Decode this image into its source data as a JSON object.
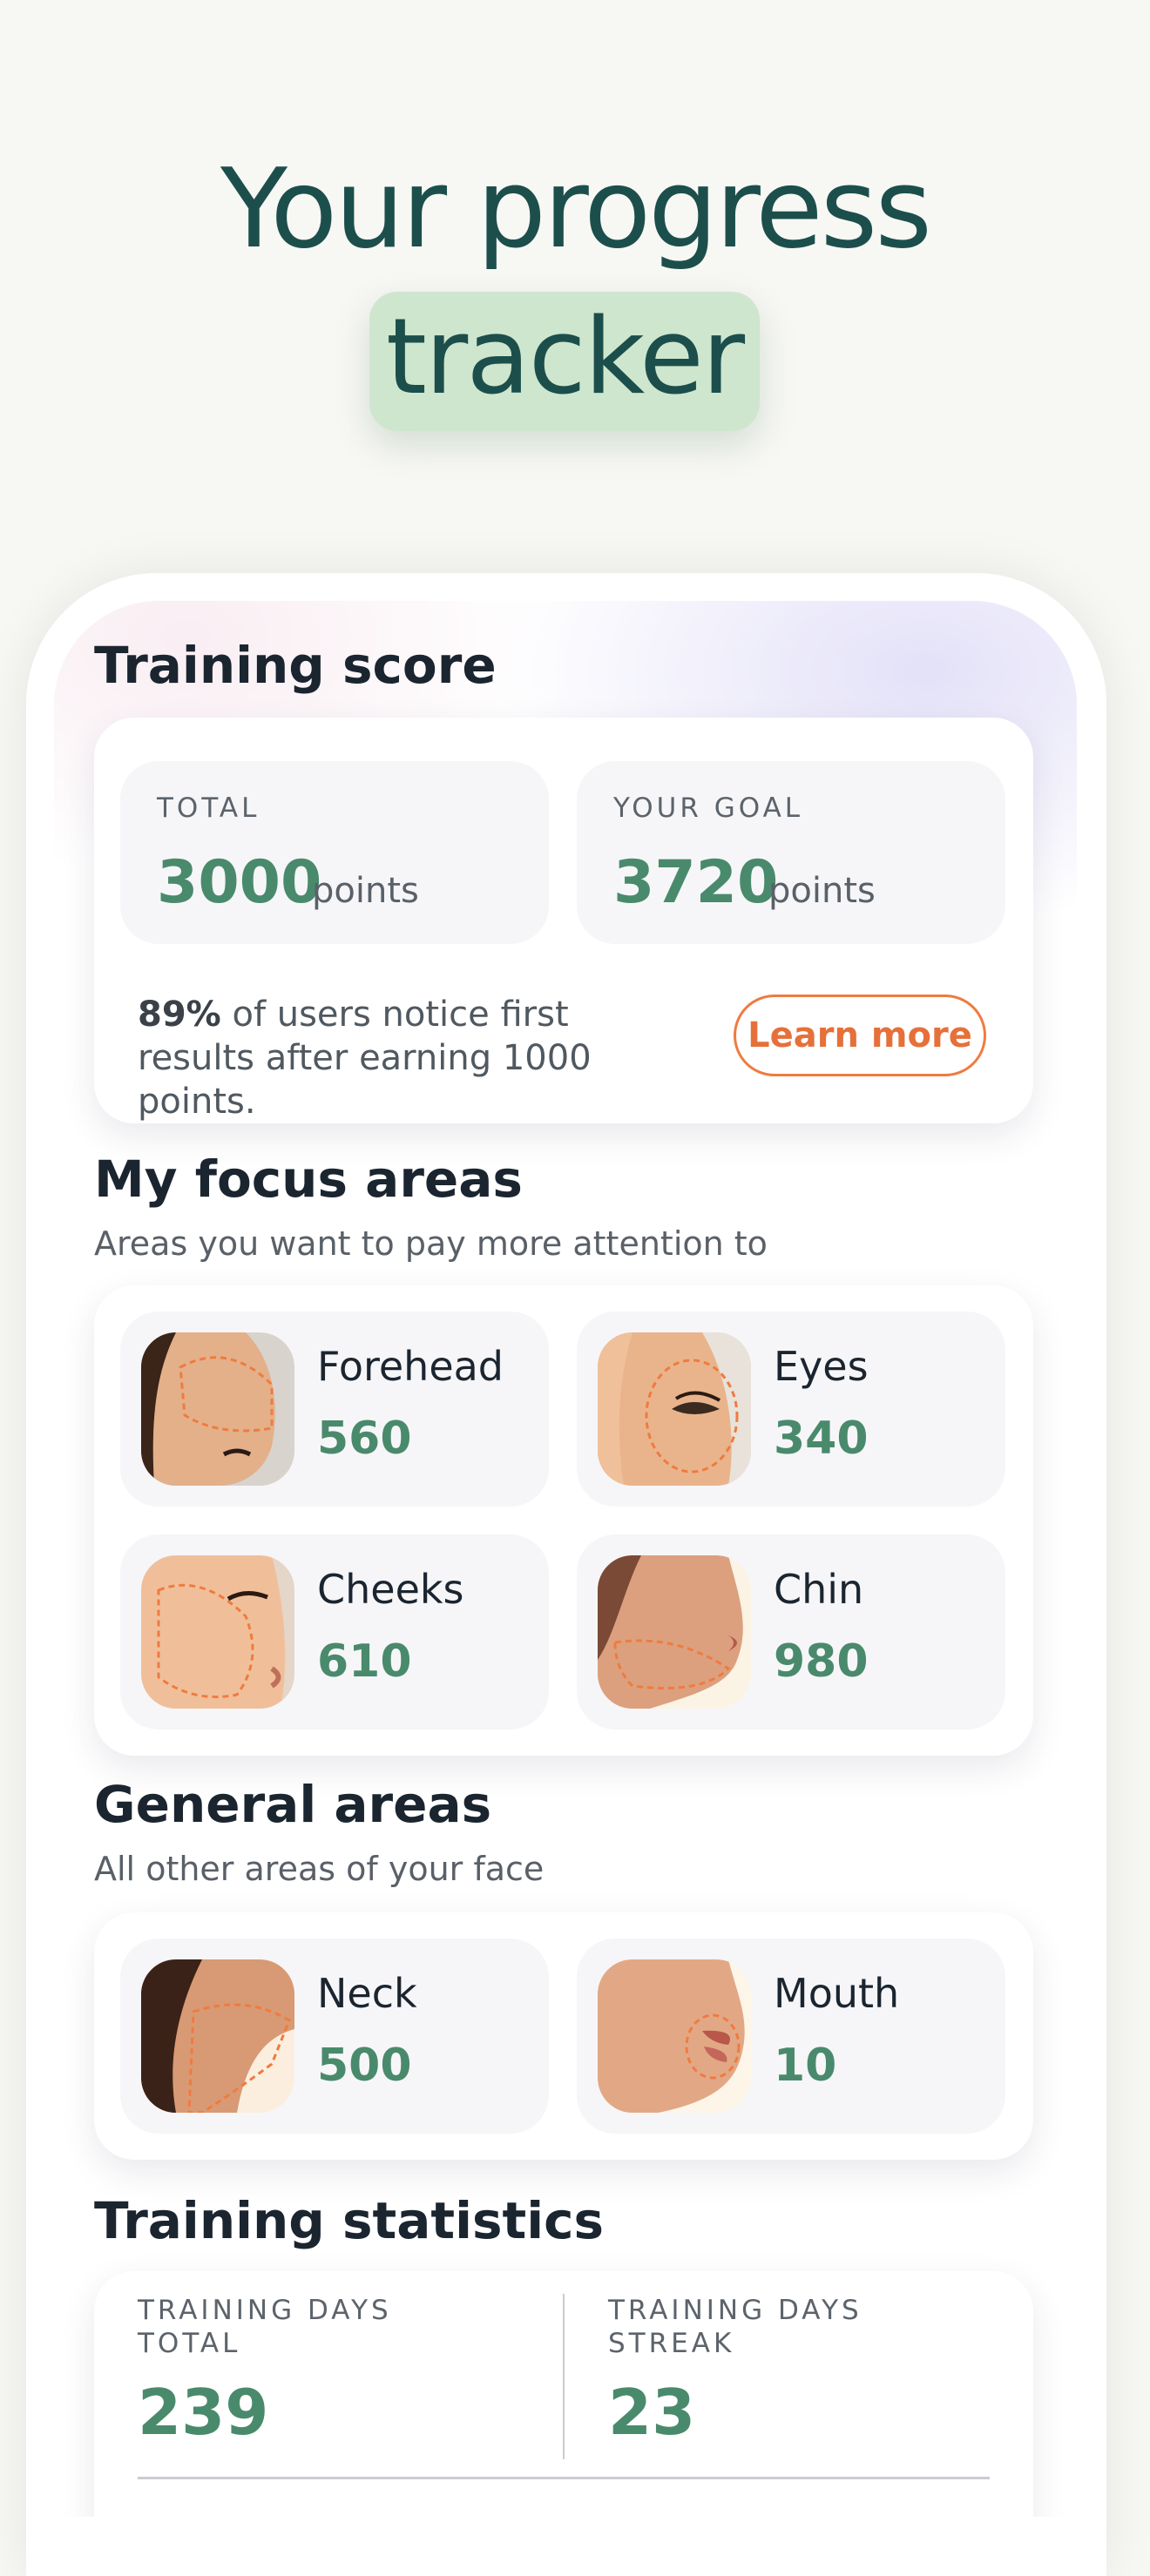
{
  "hero": {
    "line1": "Your progress",
    "line2": "tracker"
  },
  "training_score": {
    "title": "Training score",
    "total": {
      "label": "TOTAL",
      "value": "3000",
      "unit": "points"
    },
    "goal": {
      "label": "YOUR GOAL",
      "value": "3720",
      "unit": "points"
    },
    "info": {
      "percent": "89%",
      "text": " of users notice first results after earning 1000 points."
    },
    "learn_more": "Learn more"
  },
  "focus_areas": {
    "title": "My focus areas",
    "subtitle": "Areas you want to pay more attention to",
    "items": [
      {
        "name": "Forehead",
        "value": "560",
        "icon": "forehead-face-icon"
      },
      {
        "name": "Eyes",
        "value": "340",
        "icon": "eyes-face-icon"
      },
      {
        "name": "Cheeks",
        "value": "610",
        "icon": "cheeks-face-icon"
      },
      {
        "name": "Chin",
        "value": "980",
        "icon": "chin-face-icon"
      }
    ]
  },
  "general_areas": {
    "title": "General areas",
    "subtitle": "All other areas of your face",
    "items": [
      {
        "name": "Neck",
        "value": "500",
        "icon": "neck-face-icon"
      },
      {
        "name": "Mouth",
        "value": "10",
        "icon": "mouth-face-icon"
      }
    ]
  },
  "training_statistics": {
    "title": "Training statistics",
    "days_total": {
      "label": "TRAINING DAYS TOTAL",
      "value": "239"
    },
    "days_streak": {
      "label": "TRAINING DAYS STREAK",
      "value": "23"
    }
  },
  "colors": {
    "accent_green": "#4a8a6c",
    "accent_orange": "#ef7b3f",
    "title_teal": "#1c4f4c",
    "pill_green": "#cfe6ce"
  }
}
